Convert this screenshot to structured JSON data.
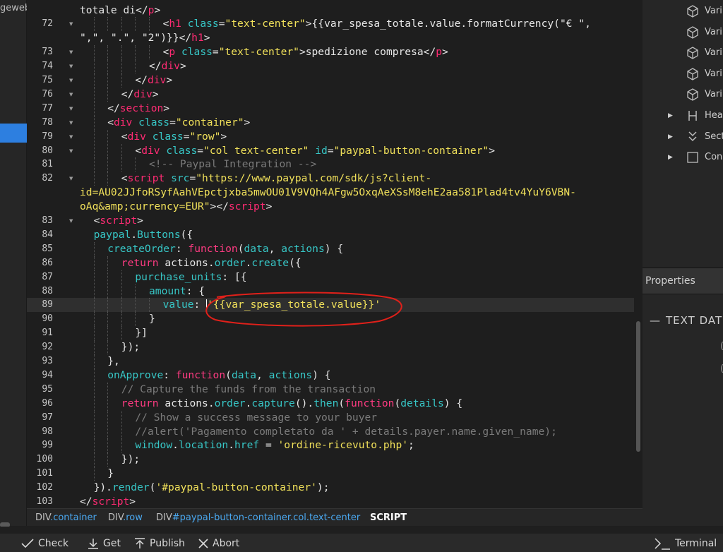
{
  "left_panel": {
    "label": "geweb"
  },
  "code": [
    {
      "n": "",
      "fold": false,
      "indent": 0,
      "tokens": [
        [
          "pl",
          "totale di</"
        ],
        [
          "tag",
          "p"
        ],
        [
          "pl",
          ">"
        ]
      ]
    },
    {
      "n": "72",
      "fold": true,
      "indent": 6,
      "tokens": [
        [
          "pl",
          "<"
        ],
        [
          "tag",
          "h1 "
        ],
        [
          "attr",
          "class"
        ],
        [
          "pl",
          "="
        ],
        [
          "str",
          "\"text-center\""
        ],
        [
          "pl",
          ">{{var_spesa_totale.value.formatCurrency(\"€ \","
        ]
      ]
    },
    {
      "n": "",
      "fold": false,
      "indent": 0,
      "tokens": [
        [
          "pl",
          "\",\", \".\", \"2\")}}</"
        ],
        [
          "tag",
          "h1"
        ],
        [
          "pl",
          ">"
        ]
      ]
    },
    {
      "n": "73",
      "fold": true,
      "indent": 6,
      "tokens": [
        [
          "pl",
          "<"
        ],
        [
          "tag",
          "p "
        ],
        [
          "attr",
          "class"
        ],
        [
          "pl",
          "="
        ],
        [
          "str",
          "\"text-center\""
        ],
        [
          "pl",
          ">spedizione compresa</"
        ],
        [
          "tag",
          "p"
        ],
        [
          "pl",
          ">"
        ]
      ]
    },
    {
      "n": "74",
      "fold": true,
      "indent": 5,
      "tokens": [
        [
          "pl",
          "</"
        ],
        [
          "tag",
          "div"
        ],
        [
          "pl",
          ">"
        ]
      ]
    },
    {
      "n": "75",
      "fold": true,
      "indent": 4,
      "tokens": [
        [
          "pl",
          "</"
        ],
        [
          "tag",
          "div"
        ],
        [
          "pl",
          ">"
        ]
      ]
    },
    {
      "n": "76",
      "fold": true,
      "indent": 3,
      "tokens": [
        [
          "pl",
          "</"
        ],
        [
          "tag",
          "div"
        ],
        [
          "pl",
          ">"
        ]
      ]
    },
    {
      "n": "77",
      "fold": true,
      "indent": 2,
      "tokens": [
        [
          "pl",
          "</"
        ],
        [
          "tag",
          "section"
        ],
        [
          "pl",
          ">"
        ]
      ]
    },
    {
      "n": "78",
      "fold": true,
      "indent": 2,
      "tokens": [
        [
          "pl",
          "<"
        ],
        [
          "tag",
          "div "
        ],
        [
          "attr",
          "class"
        ],
        [
          "pl",
          "="
        ],
        [
          "str",
          "\"container\""
        ],
        [
          "pl",
          ">"
        ]
      ]
    },
    {
      "n": "79",
      "fold": true,
      "indent": 3,
      "tokens": [
        [
          "pl",
          "<"
        ],
        [
          "tag",
          "div "
        ],
        [
          "attr",
          "class"
        ],
        [
          "pl",
          "="
        ],
        [
          "str",
          "\"row\""
        ],
        [
          "pl",
          ">"
        ]
      ]
    },
    {
      "n": "80",
      "fold": true,
      "indent": 4,
      "tokens": [
        [
          "pl",
          "<"
        ],
        [
          "tag",
          "div "
        ],
        [
          "attr",
          "class"
        ],
        [
          "pl",
          "="
        ],
        [
          "str",
          "\"col text-center\" "
        ],
        [
          "attr",
          "id"
        ],
        [
          "pl",
          "="
        ],
        [
          "str",
          "\"paypal-button-container\""
        ],
        [
          "pl",
          ">"
        ]
      ]
    },
    {
      "n": "81",
      "fold": false,
      "indent": 5,
      "tokens": [
        [
          "cm",
          "<!-- Paypal Integration -->"
        ]
      ]
    },
    {
      "n": "82",
      "fold": true,
      "indent": 3,
      "tokens": [
        [
          "pl",
          "<"
        ],
        [
          "tag",
          "script "
        ],
        [
          "attr",
          "src"
        ],
        [
          "pl",
          "="
        ],
        [
          "str",
          "\"https://www.paypal.com/sdk/js?client-"
        ]
      ]
    },
    {
      "n": "",
      "fold": false,
      "indent": 0,
      "tokens": [
        [
          "str",
          "id=AU02JJfoRSyfAahVEpctjxba5mwOU01V9VQh4AFgw5OxqAeXSsM8ehE2aa581Plad4tv4YuY6VBN-"
        ]
      ]
    },
    {
      "n": "",
      "fold": false,
      "indent": 0,
      "tokens": [
        [
          "str",
          "oAq&amp;currency=EUR\""
        ],
        [
          "pl",
          ">"
        ],
        [
          "pl",
          "</"
        ],
        [
          "tag",
          "script"
        ],
        [
          "pl",
          ">"
        ]
      ]
    },
    {
      "n": "83",
      "fold": true,
      "indent": 1,
      "tokens": [
        [
          "pl",
          "<"
        ],
        [
          "tag",
          "script"
        ],
        [
          "pl",
          ">"
        ]
      ]
    },
    {
      "n": "84",
      "fold": false,
      "indent": 1,
      "tokens": [
        [
          "fn",
          "paypal"
        ],
        [
          "pl",
          "."
        ],
        [
          "fn",
          "Buttons"
        ],
        [
          "pl",
          "({"
        ]
      ]
    },
    {
      "n": "85",
      "fold": false,
      "indent": 2,
      "tokens": [
        [
          "fn",
          "createOrder"
        ],
        [
          "pl",
          ": "
        ],
        [
          "kw",
          "function"
        ],
        [
          "pl",
          "("
        ],
        [
          "fn",
          "data"
        ],
        [
          "pl",
          ", "
        ],
        [
          "fn",
          "actions"
        ],
        [
          "pl",
          ") {"
        ]
      ]
    },
    {
      "n": "86",
      "fold": false,
      "indent": 3,
      "tokens": [
        [
          "kw",
          "return "
        ],
        [
          "pl",
          "actions."
        ],
        [
          "fn",
          "order"
        ],
        [
          "pl",
          "."
        ],
        [
          "fn",
          "create"
        ],
        [
          "pl",
          "({"
        ]
      ]
    },
    {
      "n": "87",
      "fold": false,
      "indent": 4,
      "tokens": [
        [
          "fn",
          "purchase_units"
        ],
        [
          "pl",
          ": [{"
        ]
      ]
    },
    {
      "n": "88",
      "fold": false,
      "indent": 5,
      "tokens": [
        [
          "fn",
          "amount"
        ],
        [
          "pl",
          ": {"
        ]
      ]
    },
    {
      "n": "89",
      "fold": false,
      "indent": 6,
      "highlight": true,
      "tokens": [
        [
          "fn",
          "value"
        ],
        [
          "pl",
          ": "
        ],
        [
          "str",
          "'{{var_spesa_totale.value}}'"
        ]
      ]
    },
    {
      "n": "90",
      "fold": false,
      "indent": 5,
      "tokens": [
        [
          "pl",
          "}"
        ]
      ]
    },
    {
      "n": "91",
      "fold": false,
      "indent": 4,
      "tokens": [
        [
          "pl",
          "}]"
        ]
      ]
    },
    {
      "n": "92",
      "fold": false,
      "indent": 3,
      "tokens": [
        [
          "pl",
          "});"
        ]
      ]
    },
    {
      "n": "93",
      "fold": false,
      "indent": 2,
      "tokens": [
        [
          "pl",
          "},"
        ]
      ]
    },
    {
      "n": "94",
      "fold": false,
      "indent": 2,
      "tokens": [
        [
          "fn",
          "onApprove"
        ],
        [
          "pl",
          ": "
        ],
        [
          "kw",
          "function"
        ],
        [
          "pl",
          "("
        ],
        [
          "fn",
          "data"
        ],
        [
          "pl",
          ", "
        ],
        [
          "fn",
          "actions"
        ],
        [
          "pl",
          ") {"
        ]
      ]
    },
    {
      "n": "95",
      "fold": false,
      "indent": 3,
      "tokens": [
        [
          "cm",
          "// Capture the funds from the transaction"
        ]
      ]
    },
    {
      "n": "96",
      "fold": false,
      "indent": 3,
      "tokens": [
        [
          "kw",
          "return "
        ],
        [
          "pl",
          "actions."
        ],
        [
          "fn",
          "order"
        ],
        [
          "pl",
          "."
        ],
        [
          "fn",
          "capture"
        ],
        [
          "pl",
          "()."
        ],
        [
          "fn",
          "then"
        ],
        [
          "pl",
          "("
        ],
        [
          "kw",
          "function"
        ],
        [
          "pl",
          "("
        ],
        [
          "fn",
          "details"
        ],
        [
          "pl",
          ") {"
        ]
      ]
    },
    {
      "n": "97",
      "fold": false,
      "indent": 4,
      "tokens": [
        [
          "cm",
          "// Show a success message to your buyer"
        ]
      ]
    },
    {
      "n": "98",
      "fold": false,
      "indent": 4,
      "tokens": [
        [
          "cm",
          "//alert('Pagamento completato da ' + details.payer.name.given_name);"
        ]
      ]
    },
    {
      "n": "99",
      "fold": false,
      "indent": 4,
      "tokens": [
        [
          "fn",
          "window"
        ],
        [
          "pl",
          "."
        ],
        [
          "fn",
          "location"
        ],
        [
          "pl",
          "."
        ],
        [
          "fn",
          "href"
        ],
        [
          "pl",
          " = "
        ],
        [
          "str",
          "'ordine-ricevuto.php'"
        ],
        [
          "pl",
          ";"
        ]
      ]
    },
    {
      "n": "100",
      "fold": false,
      "indent": 3,
      "tokens": [
        [
          "pl",
          "});"
        ]
      ]
    },
    {
      "n": "101",
      "fold": false,
      "indent": 2,
      "tokens": [
        [
          "pl",
          "}"
        ]
      ]
    },
    {
      "n": "102",
      "fold": false,
      "indent": 1,
      "tokens": [
        [
          "pl",
          "})."
        ],
        [
          "fn",
          "render"
        ],
        [
          "pl",
          "("
        ],
        [
          "str",
          "'#paypal-button-container'"
        ],
        [
          "pl",
          ");"
        ]
      ]
    },
    {
      "n": "103",
      "fold": false,
      "indent": 0,
      "tokens": [
        [
          "pl",
          "</"
        ],
        [
          "tag",
          "script"
        ],
        [
          "pl",
          ">"
        ]
      ]
    }
  ],
  "right_panel": {
    "items": [
      {
        "label": "Vari",
        "icon": "cube-icon",
        "arrow": false
      },
      {
        "label": "Vari",
        "icon": "cube-icon",
        "arrow": false
      },
      {
        "label": "Vari",
        "icon": "cube-icon",
        "arrow": false
      },
      {
        "label": "Vari",
        "icon": "cube-icon",
        "arrow": false
      },
      {
        "label": "Vari",
        "icon": "cube-icon",
        "arrow": false
      },
      {
        "label": "Hea",
        "icon": "heading-icon",
        "arrow": true
      },
      {
        "label": "Sect",
        "icon": "section-icon",
        "arrow": true
      },
      {
        "label": "Con",
        "icon": "container-icon",
        "arrow": true
      }
    ],
    "properties_title": "Properties",
    "text_data_label": "TEXT DAT"
  },
  "breadcrumb": [
    {
      "tag": "DIV",
      "cls": ".container",
      "current": false
    },
    {
      "tag": "DIV",
      "cls": ".row",
      "current": false
    },
    {
      "tag": "DIV",
      "cls": "#paypal-button-container.col.text-center",
      "current": false
    },
    {
      "tag": "SCRIPT",
      "cls": "",
      "current": true
    }
  ],
  "toolbar": {
    "check": "Check",
    "get": "Get",
    "publish": "Publish",
    "abort": "Abort",
    "terminal": "Terminal"
  },
  "colors": {
    "tag": "#ff2b73",
    "attr": "#37c6c6",
    "string": "#f0e05a",
    "comment": "#7a7a7a",
    "annotation": "#e0201a",
    "active_sidebar": "#2d7fe0"
  }
}
